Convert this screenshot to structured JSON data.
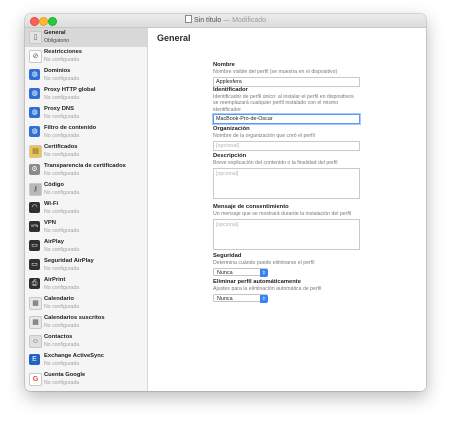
{
  "window": {
    "title": "Sin título",
    "separator": "—",
    "status": "Modificado"
  },
  "sidebar": {
    "items": [
      {
        "label": "General",
        "sub": "Obligatorio",
        "icon": "phone-settings-icon",
        "color": "#e4e4e4",
        "glyph": "▯",
        "selected": true
      },
      {
        "label": "Restricciones",
        "sub": "No configurada",
        "icon": "restrictions-icon",
        "color": "#ffffff",
        "glyph": "⊘"
      },
      {
        "label": "Dominios",
        "sub": "No configurada",
        "icon": "domains-globe-icon",
        "color": "#2f6fd6",
        "glyph": "◍"
      },
      {
        "label": "Proxy HTTP global",
        "sub": "No configurada",
        "icon": "proxy-globe-icon",
        "color": "#2f6fd6",
        "glyph": "◍"
      },
      {
        "label": "Proxy DNS",
        "sub": "No configurada",
        "icon": "dns-globe-icon",
        "color": "#2f6fd6",
        "glyph": "◍"
      },
      {
        "label": "Filtro de contenido",
        "sub": "No configurada",
        "icon": "content-filter-globe-icon",
        "color": "#2f6fd6",
        "glyph": "◍"
      },
      {
        "label": "Certificados",
        "sub": "No configurada",
        "icon": "certificate-icon",
        "color": "#f2c24a",
        "glyph": "▤"
      },
      {
        "label": "Transparencia de certificados",
        "sub": "No configurada",
        "icon": "gear-icon",
        "color": "#8b8b8b",
        "glyph": "⚙"
      },
      {
        "label": "Código",
        "sub": "No configurada",
        "icon": "key-icon",
        "color": "#b9b9b9",
        "glyph": "⚷"
      },
      {
        "label": "Wi-Fi",
        "sub": "No configurada",
        "icon": "wifi-icon",
        "color": "#2f2f2f",
        "glyph": "◠"
      },
      {
        "label": "VPN",
        "sub": "No configurada",
        "icon": "vpn-icon",
        "color": "#2f2f2f",
        "glyph": "VPN"
      },
      {
        "label": "AirPlay",
        "sub": "No configurada",
        "icon": "airplay-icon",
        "color": "#2f2f2f",
        "glyph": "▭"
      },
      {
        "label": "Seguridad AirPlay",
        "sub": "No configurada",
        "icon": "airplay-security-icon",
        "color": "#2f2f2f",
        "glyph": "▭"
      },
      {
        "label": "AirPrint",
        "sub": "No configurada",
        "icon": "printer-icon",
        "color": "#2f2f2f",
        "glyph": "⎙"
      },
      {
        "label": "Calendario",
        "sub": "No configurada",
        "icon": "calendar-icon",
        "color": "#e8e8e8",
        "glyph": "▦"
      },
      {
        "label": "Calendarios suscritos",
        "sub": "No configurada",
        "icon": "subscribed-calendars-icon",
        "color": "#e8e8e8",
        "glyph": "▦"
      },
      {
        "label": "Contactos",
        "sub": "No configurada",
        "icon": "contacts-icon",
        "color": "#e0e0e0",
        "glyph": "☺"
      },
      {
        "label": "Exchange ActiveSync",
        "sub": "No configurada",
        "icon": "exchange-icon",
        "color": "#1f63c3",
        "glyph": "E"
      },
      {
        "label": "Cuenta Google",
        "sub": "No configurada",
        "icon": "google-icon",
        "color": "#ffffff",
        "glyph": "G"
      }
    ]
  },
  "main": {
    "title": "General",
    "name": {
      "label": "Nombre",
      "desc": "Nombre visible del perfil (se muestra en el dispositivo)",
      "value": "Applesfera"
    },
    "identifier": {
      "label": "Identificador",
      "desc": "Identificador de perfil único: al instalar el perfil en dispositivos se reemplazará cualquier perfil instalado con el mismo identificador",
      "value": "MacBook-Pro-de-Oscar"
    },
    "organization": {
      "label": "Organización",
      "desc": "Nombre de la organización que creó el perfil",
      "placeholder": "[opcional]"
    },
    "description": {
      "label": "Descripción",
      "desc": "Breve explicación del contenido o la finalidad del perfil",
      "placeholder": "[opcional]"
    },
    "consent": {
      "label": "Mensaje de consentimiento",
      "desc": "Un mensaje que se mostrará durante la instalación del perfil",
      "placeholder": "[opcional]"
    },
    "security": {
      "label": "Seguridad",
      "desc": "Determina cuándo puede eliminarse el perfil",
      "value": "Nunca"
    },
    "auto_remove": {
      "label": "Eliminar perfil automáticamente",
      "desc": "Ajustes para la eliminación automática de perfil",
      "value": "Nunca"
    }
  }
}
